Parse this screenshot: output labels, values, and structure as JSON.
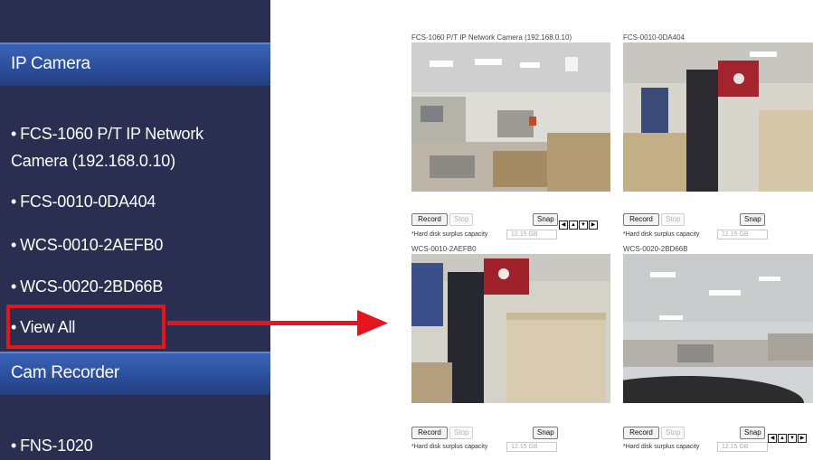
{
  "sidebar": {
    "ip_camera_header": "IP Camera",
    "items": [
      {
        "bullet": "•",
        "label": "FCS-1060 P/T IP Network Camera (192.168.0.10)"
      },
      {
        "bullet": "•",
        "label": "FCS-0010-0DA404"
      },
      {
        "bullet": "•",
        "label": "WCS-0010-2AEFB0"
      },
      {
        "bullet": "•",
        "label": "WCS-0020-2BD66B"
      },
      {
        "bullet": "•",
        "label": "View All"
      }
    ],
    "cam_recorder_header": "Cam Recorder",
    "recorder_items": [
      {
        "bullet": "•",
        "label": "FNS-1020"
      }
    ]
  },
  "accent_colors": {
    "sidebar_bg": "#2a2f52",
    "header_blue": "#2c4f9c",
    "highlight_red": "#e8141c"
  },
  "cameras": [
    {
      "title": "FCS-1060 P/T IP Network Camera (192.168.0.10)",
      "record": "Record",
      "stop": "Stop",
      "snap": "Snap",
      "capacity_label": "*Hard disk surplus capacity",
      "capacity_value": "12.15  GB",
      "has_ptz": true
    },
    {
      "title": "FCS-0010-0DA404",
      "record": "Record",
      "stop": "Stop",
      "snap": "Snap",
      "capacity_label": "*Hard disk surplus capacity",
      "capacity_value": "12.15  GB",
      "has_ptz": false
    },
    {
      "title": "WCS-0010-2AEFB0",
      "record": "Record",
      "stop": "Stop",
      "snap": "Snap",
      "capacity_label": "*Hard disk surplus capacity",
      "capacity_value": "12.15  GB",
      "has_ptz": false
    },
    {
      "title": "WCS-0020-2BD66B",
      "record": "Record",
      "stop": "Stop",
      "snap": "Snap",
      "capacity_label": "*Hard disk surplus capacity",
      "capacity_value": "12.15  GB",
      "has_ptz": true
    }
  ],
  "ptz_icons": [
    "left-arrow-icon",
    "up-arrow-icon",
    "down-arrow-icon",
    "right-arrow-icon"
  ],
  "ptz_glyphs": [
    "◀",
    "▲",
    "▼",
    "▶"
  ]
}
